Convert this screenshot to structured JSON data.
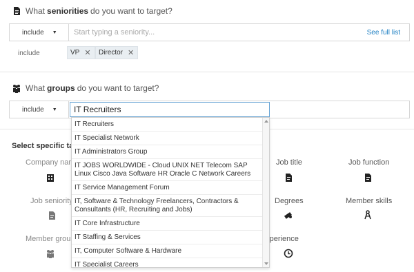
{
  "seniorities": {
    "title_pre": "What",
    "title_bold": "seniorities",
    "title_post": "do you want to target?",
    "mode": "include",
    "placeholder": "Start typing a seniority...",
    "see_full_list": "See full list",
    "include_label": "include",
    "tags": [
      "VP",
      "Director"
    ]
  },
  "groups": {
    "title_pre": "What",
    "title_bold": "groups",
    "title_post": "do you want to target?",
    "mode": "include",
    "input_value": "IT Recruiters",
    "suggestions": [
      "IT Recruiters",
      "IT Specialist Network",
      "IT Administrators Group",
      "IT JOBS WORLDWIDE - Cloud UNIX NET Telecom SAP Linux Cisco Java Software HR Oracle C Network Careers",
      "IT Service Management Forum",
      "IT, Software & Technology Freelancers, Contractors & Consultants (HR, Recruiting and Jobs)",
      "IT Core Infrastructure",
      "IT Staffing & Services",
      "IT, Computer Software & Hardware",
      "IT Specialist Careers"
    ]
  },
  "targeting": {
    "title": "Select specific targeting criteria",
    "categories": {
      "company_name": "Company name",
      "job_title": "Job title",
      "job_function": "Job function",
      "job_seniority": "Job seniority",
      "degrees": "Degrees",
      "member_skills": "Member skills",
      "member_groups": "Member groups",
      "years_experience": "Years of experience"
    }
  }
}
